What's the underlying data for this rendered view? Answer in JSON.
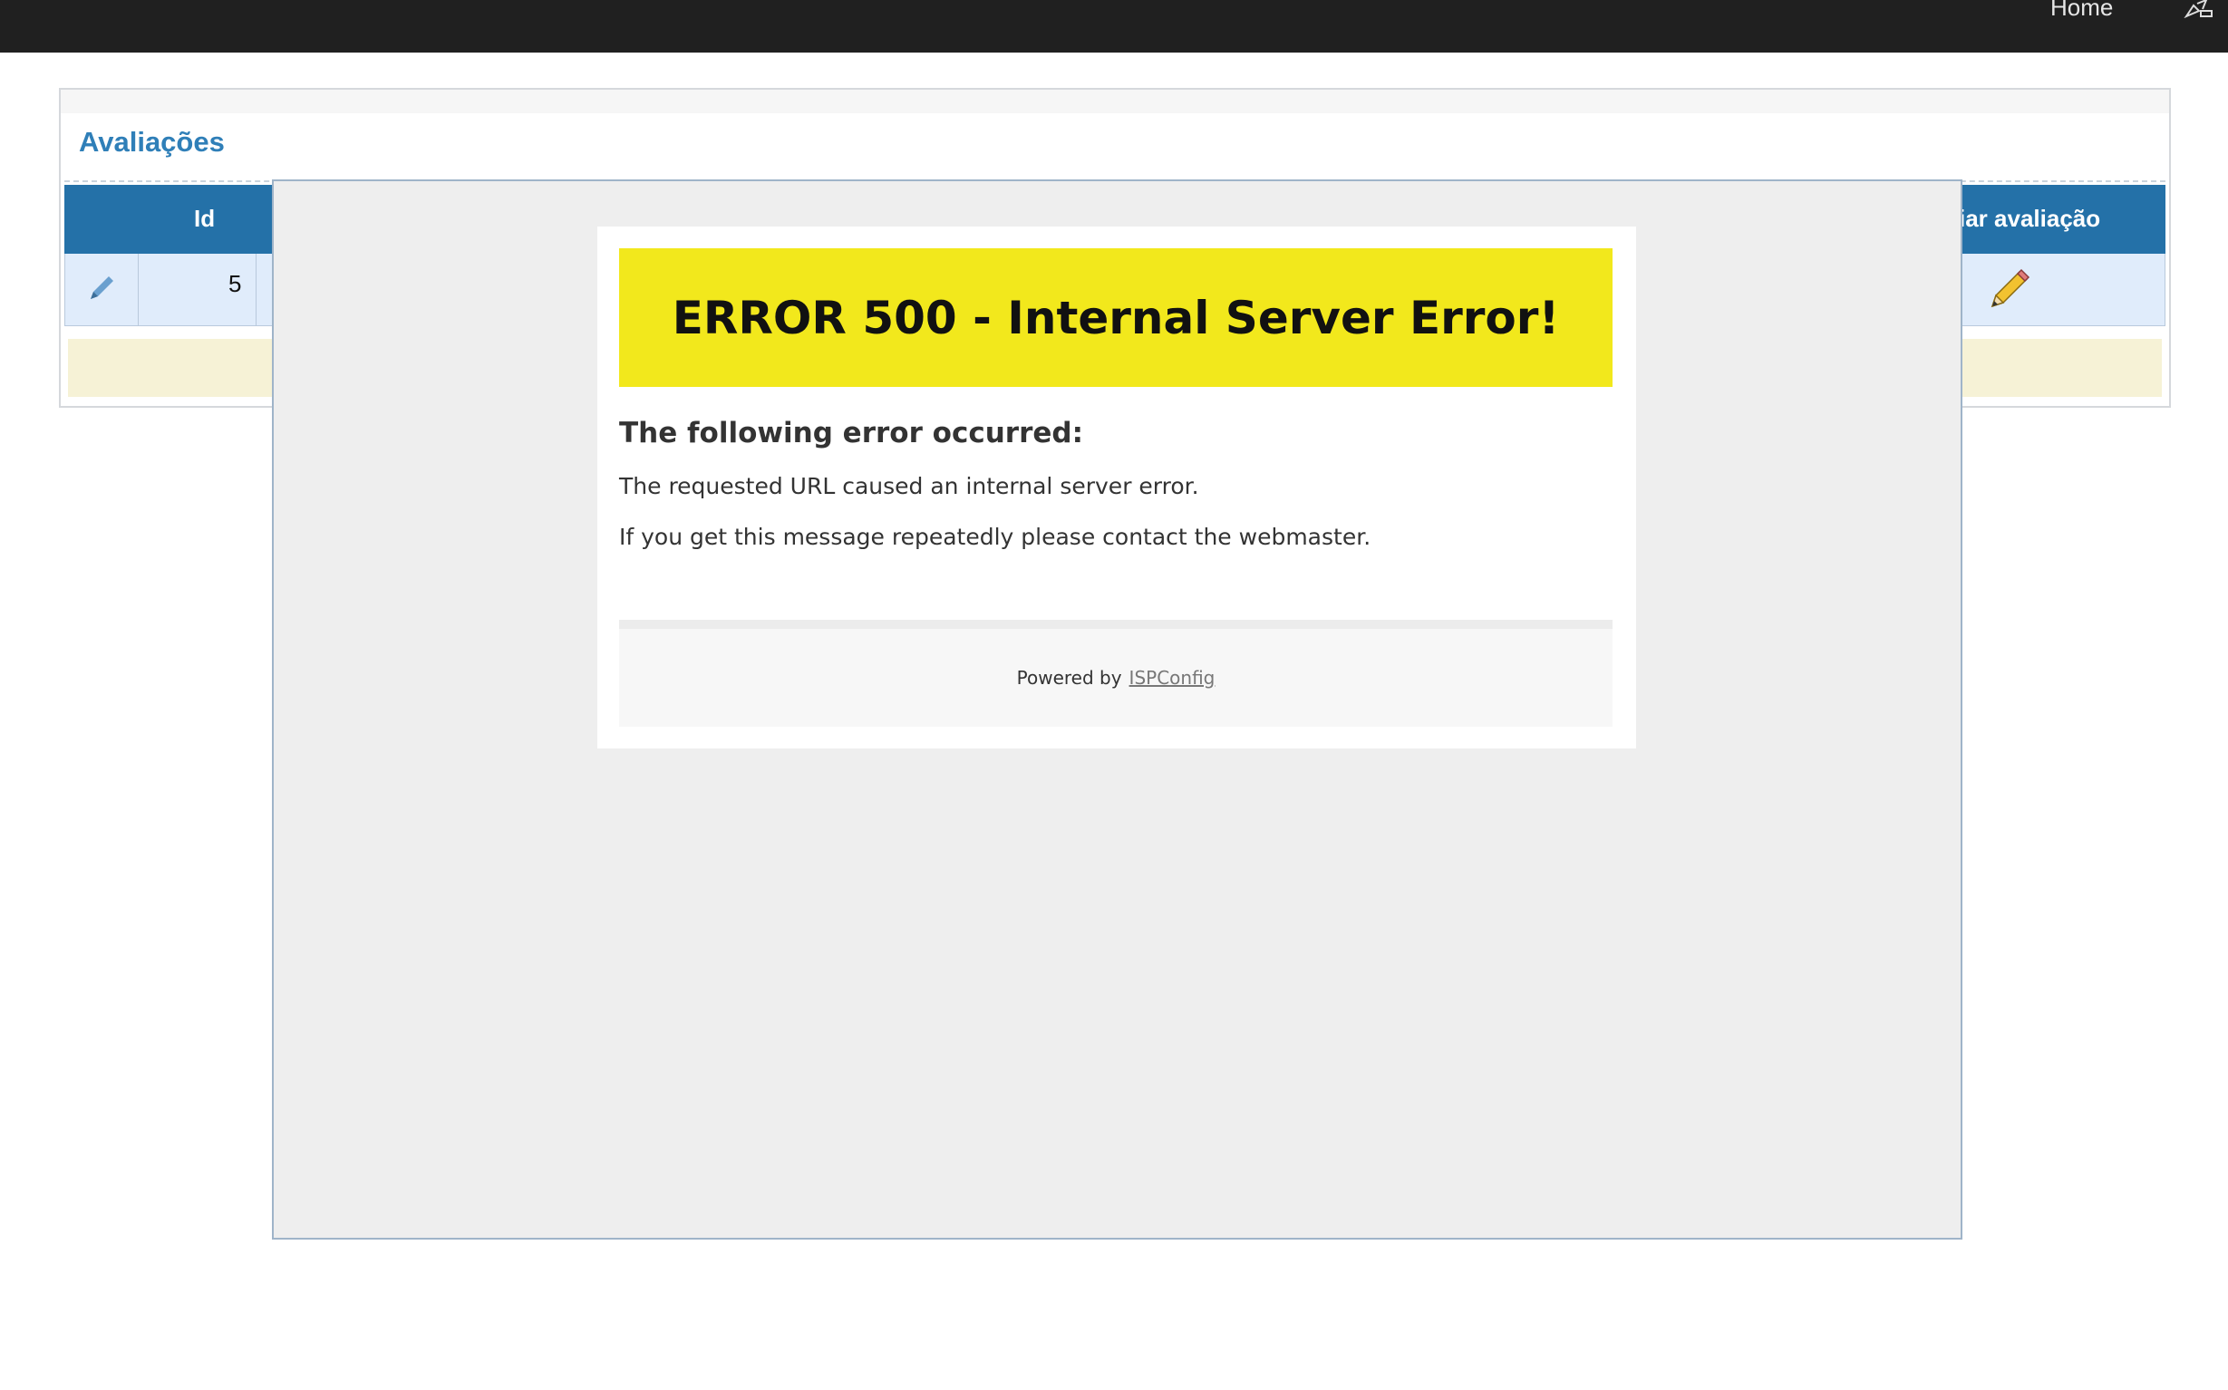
{
  "topbar": {
    "home_label": "Home",
    "corner_icon": "edit-user-icon"
  },
  "panel": {
    "title": "Avaliações",
    "table": {
      "headers": {
        "id": "Id",
        "action": "iar avaliação"
      },
      "rows": [
        {
          "id": "5",
          "edit_icon": "pencil-small-icon",
          "action_icon": "pencil-icon"
        }
      ]
    }
  },
  "error": {
    "banner": "ERROR 500 - Internal Server Error!",
    "subtitle": "The following error occurred:",
    "line1": "The requested URL caused an internal server error.",
    "line2": "If you get this message repeatedly please contact the webmaster.",
    "powered_prefix": "Powered by",
    "powered_link": "ISPConfig"
  },
  "colors": {
    "topbar": "#202020",
    "accent": "#2471a8",
    "title": "#2f7fb8",
    "row_bg": "#e0ecfb",
    "footer_bar": "#f6f2d6",
    "banner": "#f2e81c",
    "overlay": "#eeeeee"
  }
}
